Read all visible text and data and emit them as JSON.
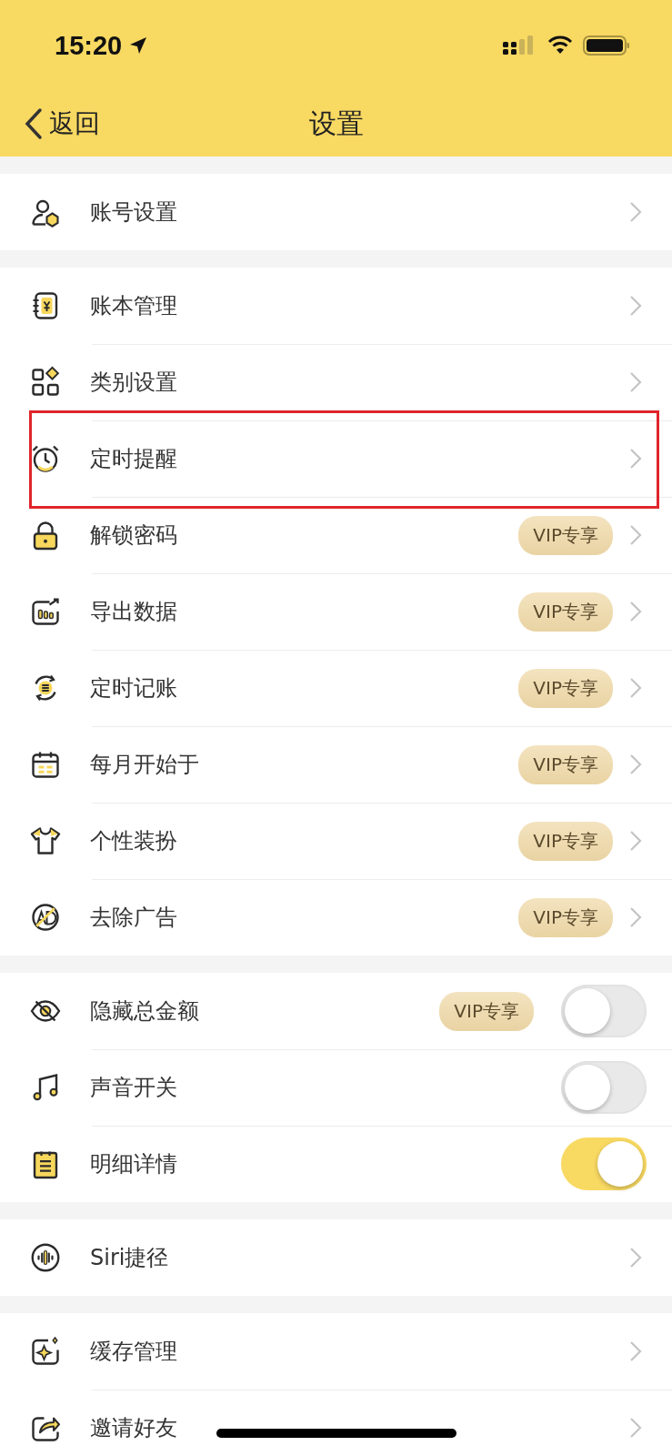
{
  "status_bar": {
    "time": "15:20"
  },
  "nav_bar": {
    "back": "返回",
    "title": "设置"
  },
  "sections": [
    {
      "rows": [
        {
          "label": "账号设置",
          "kind": "chevron"
        }
      ]
    },
    {
      "rows": [
        {
          "label": "账本管理",
          "kind": "chevron"
        },
        {
          "label": "类别设置",
          "kind": "chevron"
        },
        {
          "label": "定时提醒",
          "kind": "chevron",
          "highlighted": true
        },
        {
          "label": "解锁密码",
          "kind": "chevron",
          "badge": "VIP专享"
        },
        {
          "label": "导出数据",
          "kind": "chevron",
          "badge": "VIP专享"
        },
        {
          "label": "定时记账",
          "kind": "chevron",
          "badge": "VIP专享"
        },
        {
          "label": "每月开始于",
          "kind": "chevron",
          "badge": "VIP专享"
        },
        {
          "label": "个性装扮",
          "kind": "chevron",
          "badge": "VIP专享"
        },
        {
          "label": "去除广告",
          "kind": "chevron",
          "badge": "VIP专享"
        }
      ]
    },
    {
      "rows": [
        {
          "label": "隐藏总金额",
          "kind": "toggle",
          "badge": "VIP专享",
          "on": false
        },
        {
          "label": "声音开关",
          "kind": "toggle",
          "on": false
        },
        {
          "label": "明细详情",
          "kind": "toggle",
          "on": true
        }
      ]
    },
    {
      "rows": [
        {
          "label": "Siri捷径",
          "kind": "chevron"
        }
      ]
    },
    {
      "rows": [
        {
          "label": "缓存管理",
          "kind": "chevron"
        },
        {
          "label": "邀请好友",
          "kind": "chevron"
        }
      ]
    }
  ]
}
